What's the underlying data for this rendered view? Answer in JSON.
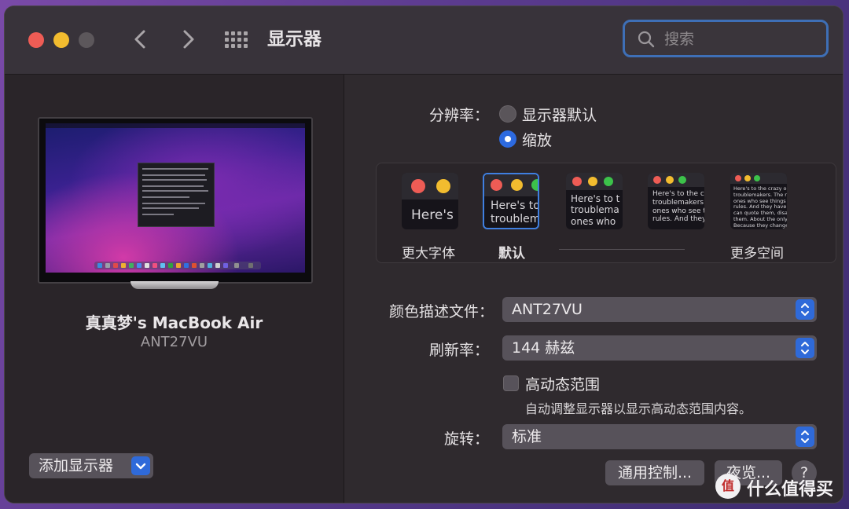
{
  "window": {
    "title": "显示器"
  },
  "search": {
    "placeholder": "搜索"
  },
  "device": {
    "name": "真真梦's MacBook Air",
    "model": "ANT27VU"
  },
  "add_display": {
    "label": "添加显示器"
  },
  "resolution": {
    "label": "分辨率：",
    "options": [
      {
        "label": "显示器默认",
        "selected": false
      },
      {
        "label": "缩放",
        "selected": true
      }
    ]
  },
  "scale": {
    "thumbs": [
      {
        "text": "Here's",
        "selected": false
      },
      {
        "text": "Here's to\ntroublem",
        "selected": true
      },
      {
        "text": "Here's to t\ntroublema\nones who",
        "selected": false
      },
      {
        "text": "Here's to the cr\ntroublemakers.\nones who see t\nrules. And they",
        "selected": false
      },
      {
        "text": "Here's to the crazy one\ntroublemakers. The rou\nones who see things di\nrules. And they have no\ncan quote them, disagre\nthem. About the only th\nBecause they change th",
        "selected": false
      }
    ],
    "labels": {
      "larger": "更大字体",
      "default": "默认",
      "more": "更多空间"
    }
  },
  "color_profile": {
    "label": "颜色描述文件：",
    "value": "ANT27VU"
  },
  "refresh_rate": {
    "label": "刷新率：",
    "value": "144 赫兹"
  },
  "hdr": {
    "label": "高动态范围",
    "checked": false,
    "description": "自动调整显示器以显示高动态范围内容。"
  },
  "rotation": {
    "label": "旋转：",
    "value": "标准"
  },
  "buttons": {
    "universal_control": "通用控制...",
    "night_shift": "夜览...",
    "help": "?"
  },
  "watermark": {
    "badge": "值",
    "text": "什么值得买"
  },
  "colors": {
    "accent": "#2d6ae0",
    "focus_ring": "#3e6fb6",
    "red": "#ee5c55",
    "yellow": "#f2bc2f"
  }
}
